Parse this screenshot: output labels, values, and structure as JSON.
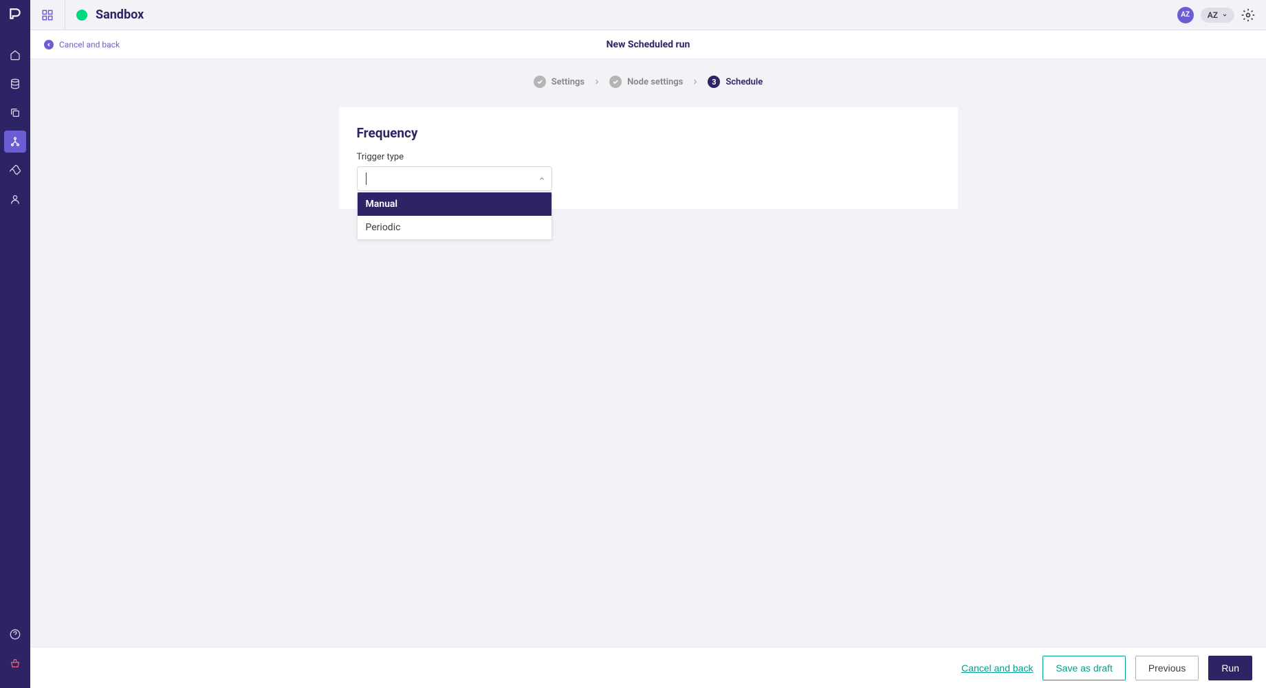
{
  "header": {
    "workspace_title": "Sandbox",
    "avatar_initials_small": "AZ",
    "user_chip_label": "AZ"
  },
  "subheader": {
    "cancel_label": "Cancel and back",
    "page_title": "New Scheduled run"
  },
  "stepper": {
    "step1_label": "Settings",
    "step2_label": "Node settings",
    "step3_number": "3",
    "step3_label": "Schedule"
  },
  "card": {
    "title": "Frequency",
    "field_label": "Trigger type",
    "select_value": "",
    "options": [
      "Manual",
      "Periodic"
    ]
  },
  "footer": {
    "cancel_label": "Cancel and back",
    "save_draft_label": "Save as draft",
    "previous_label": "Previous",
    "run_label": "Run"
  }
}
